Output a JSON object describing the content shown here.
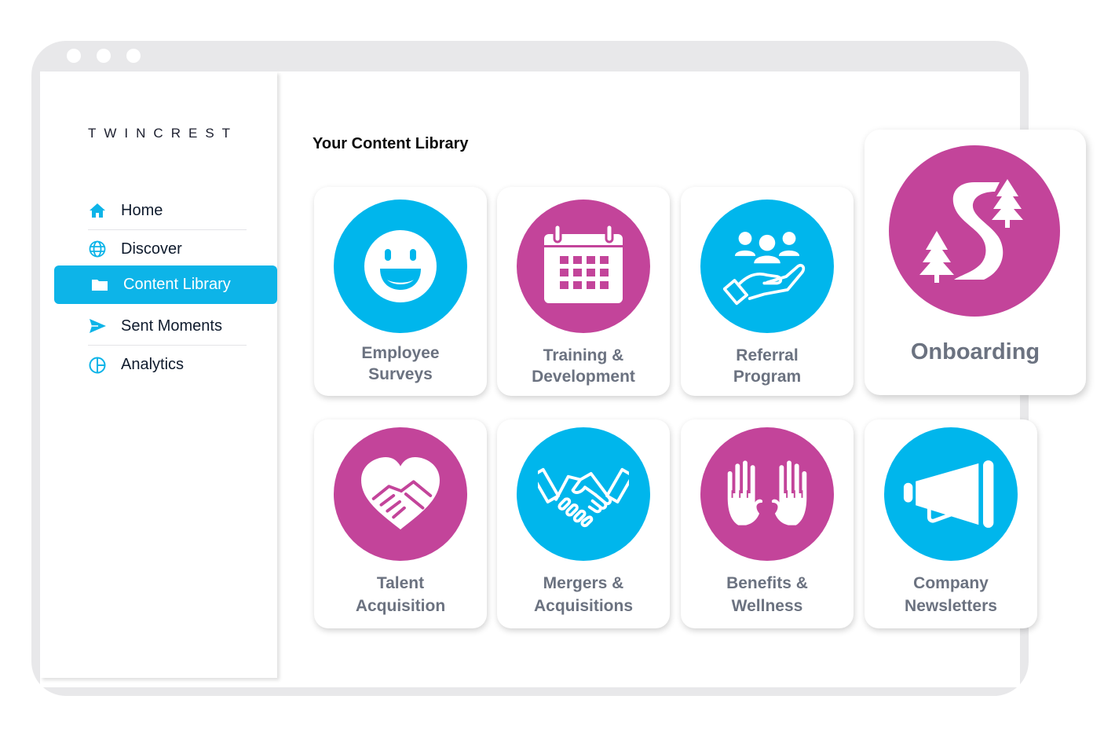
{
  "brand": {
    "logo_text": "TWINCREST"
  },
  "sidebar": {
    "items": [
      {
        "label": "Home",
        "icon": "home-icon"
      },
      {
        "label": "Discover",
        "icon": "globe-icon"
      },
      {
        "label": "Content Library",
        "icon": "folder-icon",
        "active": true
      },
      {
        "label": "Sent Moments",
        "icon": "send-icon"
      },
      {
        "label": "Analytics",
        "icon": "pie-chart-icon"
      }
    ]
  },
  "main": {
    "title": "Your Content Library",
    "cards": [
      {
        "label": "Employee\nSurveys",
        "icon": "smiley-face-icon",
        "color": "#00b6ec"
      },
      {
        "label": "Training &\nDevelopment",
        "icon": "calendar-icon",
        "color": "#c3449a"
      },
      {
        "label": "Referral\nProgram",
        "icon": "people-in-hand-icon",
        "color": "#00b6ec"
      },
      {
        "label": "Onboarding",
        "icon": "winding-road-trees-icon",
        "color": "#c3449a"
      },
      {
        "label": "Talent\nAcquisition",
        "icon": "heart-handshake-icon",
        "color": "#c3449a"
      },
      {
        "label": "Mergers &\nAcquisitions",
        "icon": "handshake-icon",
        "color": "#00b6ec"
      },
      {
        "label": "Benefits &\nWellness",
        "icon": "hands-heart-icon",
        "color": "#c3449a"
      },
      {
        "label": "Company\nNewsletters",
        "icon": "megaphone-icon",
        "color": "#00b6ec"
      }
    ]
  },
  "colors": {
    "accent_blue": "#00b6ec",
    "accent_pink": "#c3449a",
    "nav_active": "#0db4e8"
  }
}
